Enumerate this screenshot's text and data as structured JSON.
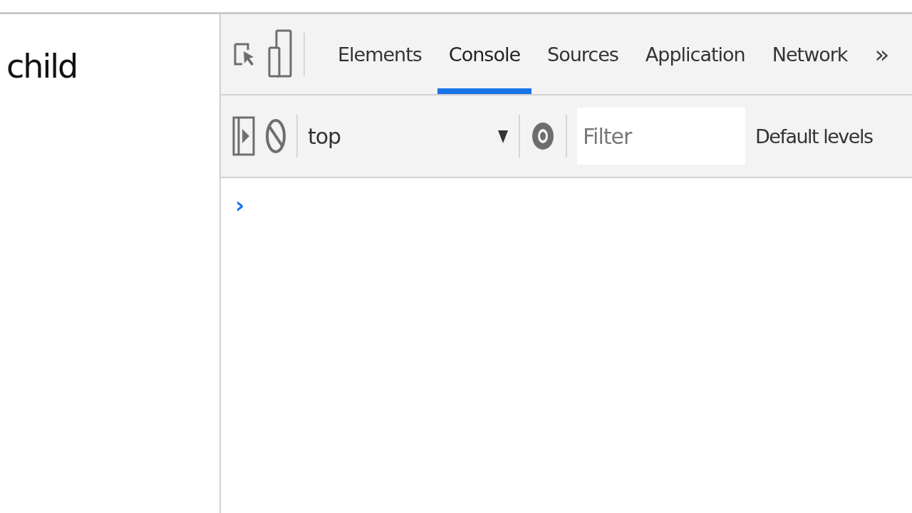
{
  "page": {
    "text": "child"
  },
  "devtools": {
    "tabs": [
      {
        "label": "Elements",
        "selected": false
      },
      {
        "label": "Console",
        "selected": true
      },
      {
        "label": "Sources",
        "selected": false
      },
      {
        "label": "Application",
        "selected": false
      },
      {
        "label": "Network",
        "selected": false
      }
    ],
    "more_tabs": "»",
    "toolbar": {
      "context": "top",
      "filter": {
        "placeholder": "Filter"
      },
      "levels": "Default levels"
    },
    "console": {
      "prompt": "›"
    }
  }
}
